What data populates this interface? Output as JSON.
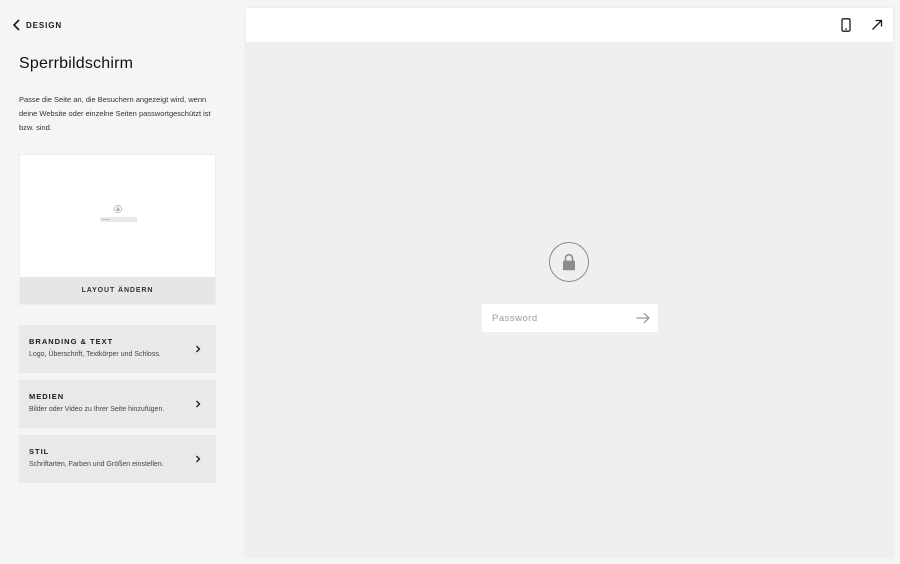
{
  "nav": {
    "back_label": "DESIGN"
  },
  "panel": {
    "title": "Sperrbildschirm",
    "description": "Passe die Seite an, die Besuchern angezeigt wird, wenn deine Website oder einzelne Seiten passwortgeschützt ist bzw. sind.",
    "layout_button": "LAYOUT ÄNDERN"
  },
  "menu": [
    {
      "title": "BRANDING & TEXT",
      "subtitle": "Logo, Überschrift, Textkörper und Schloss."
    },
    {
      "title": "MEDIEN",
      "subtitle": "Bilder oder Video zu Ihrer Seite hinzufügen."
    },
    {
      "title": "STIL",
      "subtitle": "Schriftarten, Farben und Größen einstellen."
    }
  ],
  "preview": {
    "toolbar_icons": [
      "mobile-icon",
      "expand-icon"
    ],
    "lock_icon": "lock-icon",
    "password_placeholder": "Password",
    "password_value": "",
    "submit_icon": "arrow-right-icon"
  },
  "colors": {
    "panel_bg": "#f5f5f5",
    "menu_item_bg": "#e9e9e9",
    "preview_bg": "#efefef",
    "toolbar_bg": "#ffffff",
    "lock_gray": "#8c8c8c"
  }
}
